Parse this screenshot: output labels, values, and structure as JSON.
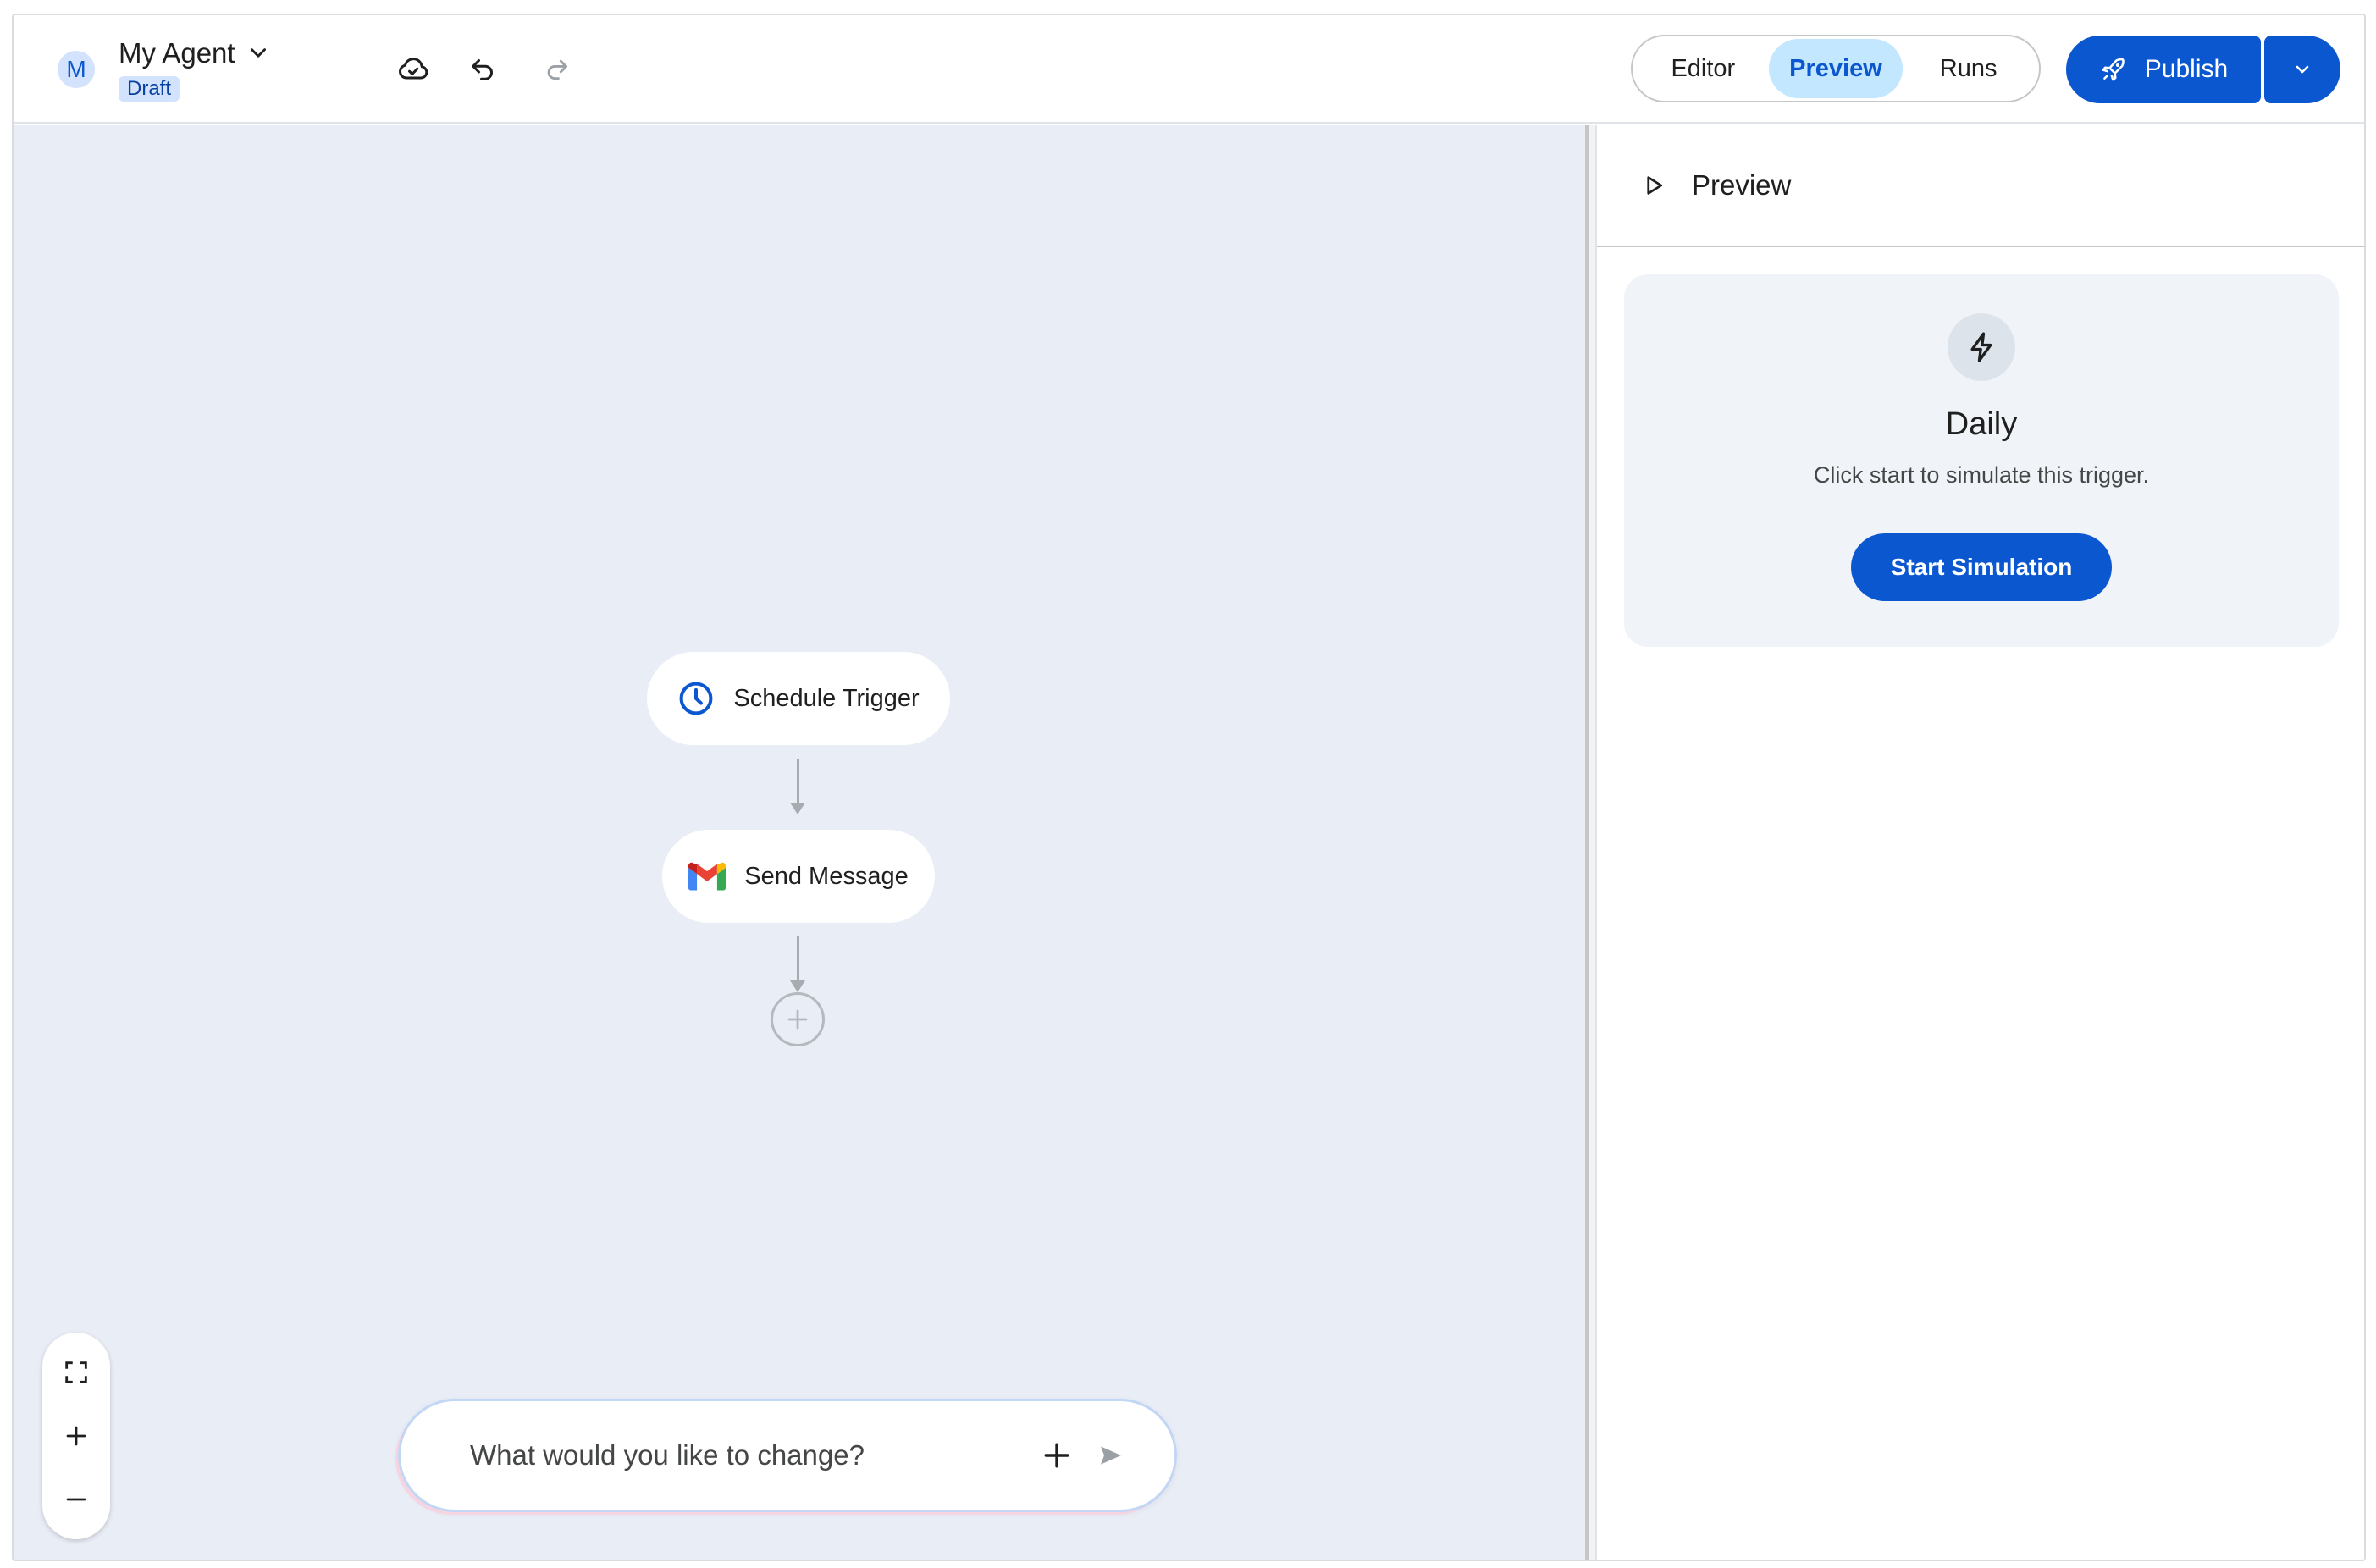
{
  "header": {
    "avatar_letter": "M",
    "agent_name": "My Agent",
    "status_badge": "Draft",
    "tabs": [
      {
        "label": "Editor"
      },
      {
        "label": "Preview"
      },
      {
        "label": "Runs"
      }
    ],
    "active_tab": "Preview",
    "publish_label": "Publish"
  },
  "canvas": {
    "nodes": [
      {
        "label": "Schedule Trigger",
        "icon": "clock-icon"
      },
      {
        "label": "Send Message",
        "icon": "gmail-icon"
      }
    ],
    "prompt": {
      "placeholder": "What would you like to change?"
    }
  },
  "preview_panel": {
    "title": "Preview",
    "trigger_card": {
      "icon": "bolt-icon",
      "title": "Daily",
      "subtitle": "Click start to simulate this trigger.",
      "button_label": "Start Simulation"
    }
  },
  "colors": {
    "primary": "#0b57d0",
    "active_tab_bg": "#c2e7ff",
    "canvas_bg": "#e9edf6",
    "card_bg": "#f0f4f9"
  }
}
